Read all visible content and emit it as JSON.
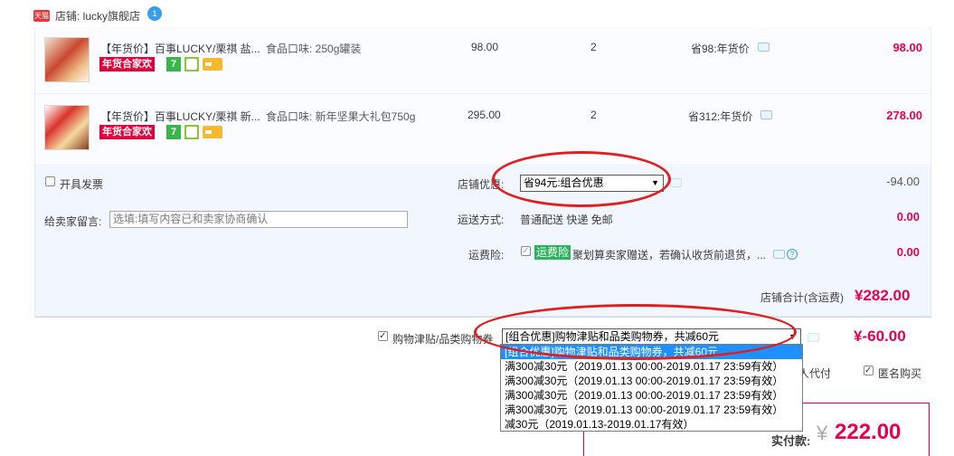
{
  "shop": {
    "logo_text": "天猫",
    "name": "店铺: lucky旗舰店",
    "chat_badge": "1"
  },
  "items": [
    {
      "title": "【年货价】百事LUCKY/栗祺 盐...",
      "sku": "食品口味: 250g罐装",
      "unit_price": "98.00",
      "quantity": "2",
      "discount": "省98:年货价",
      "subtotal": "98.00",
      "promo_tag": "年货合家欢"
    },
    {
      "title": "【年货价】百事LUCKY/栗祺 新...",
      "sku": "食品口味: 新年坚果大礼包750g",
      "unit_price": "295.00",
      "quantity": "2",
      "discount": "省312:年货价",
      "subtotal": "278.00",
      "promo_tag": "年货合家欢"
    }
  ],
  "invoice": {
    "label": "开具发票"
  },
  "shop_discount": {
    "label": "店铺优惠:",
    "selected": "省94元:组合优惠",
    "amount": "-94.00"
  },
  "message": {
    "label": "给卖家留言:",
    "placeholder": "选填:填写内容已和卖家协商确认"
  },
  "shipping": {
    "label": "运送方式:",
    "value": "普通配送 快递 免邮",
    "amount": "0.00"
  },
  "insurance": {
    "label": "运费险:",
    "tag": "运费险",
    "text": "聚划算卖家赠送，若确认收货前退货，...",
    "amount": "0.00"
  },
  "shop_total": {
    "label": "店铺合计(含运费)",
    "value": "¥282.00"
  },
  "coupon": {
    "label": "购物津贴/品类购物券",
    "selected": "[组合优惠]购物津贴和品类购物券，共减60元",
    "amount": "¥-60.00",
    "options": [
      "[组合优惠]购物津贴和品类购物券，共减60元",
      "满300减30元（2019.01.13 00:00-2019.01.17 23:59有效）",
      "满300减30元（2019.01.13 00:00-2019.01.17 23:59有效）",
      "满300减30元（2019.01.13 00:00-2019.01.17 23:59有效）",
      "满300减30元（2019.01.13 00:00-2019.01.17 23:59有效）",
      "减30元（2019.01.13-2019.01.17有效）"
    ]
  },
  "pay_for_other": {
    "label": "人代付"
  },
  "anonymous": {
    "label": "匿名购买"
  },
  "total": {
    "label": "实付款:",
    "currency": "¥",
    "value": "222.00"
  },
  "colors": {
    "accent_red": "#e8004e",
    "select_blue": "#1e90ff",
    "annotation_red": "#e02020"
  }
}
